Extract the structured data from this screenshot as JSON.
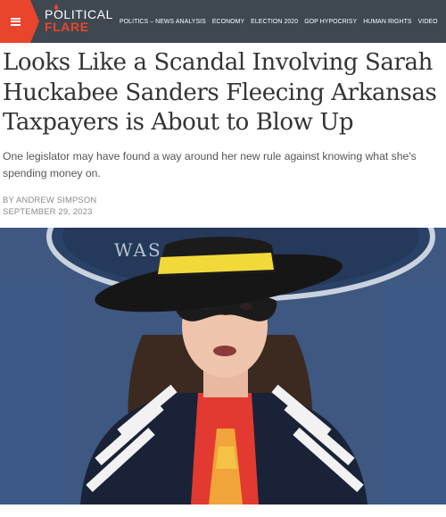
{
  "header": {
    "logo_line1": "POLITICAL",
    "logo_line2": "FLARE",
    "nav": [
      "POLITICS – NEWS ANALYSIS",
      "ECONOMY",
      "ELECTION 2020",
      "GOP HYPOCRISY",
      "HUMAN RIGHTS",
      "VIDEO"
    ]
  },
  "article": {
    "headline": "Looks Like a Scandal Involving Sarah Huckabee Sanders Fleecing Arkansas Taxpayers is About to Blow Up",
    "dek": "One legislator may have found a way around her new rule against knowing what she's spending money on.",
    "byline": "BY ANDREW SIMPSON",
    "date": "SEPTEMBER 29, 2023",
    "hero_backdrop_text": "WAS"
  },
  "colors": {
    "navbar": "#3f4750",
    "accent": "#e8452c",
    "headline": "#333333",
    "podium_blue": "#25395a"
  },
  "icons": {
    "menu": "hamburger-icon"
  }
}
